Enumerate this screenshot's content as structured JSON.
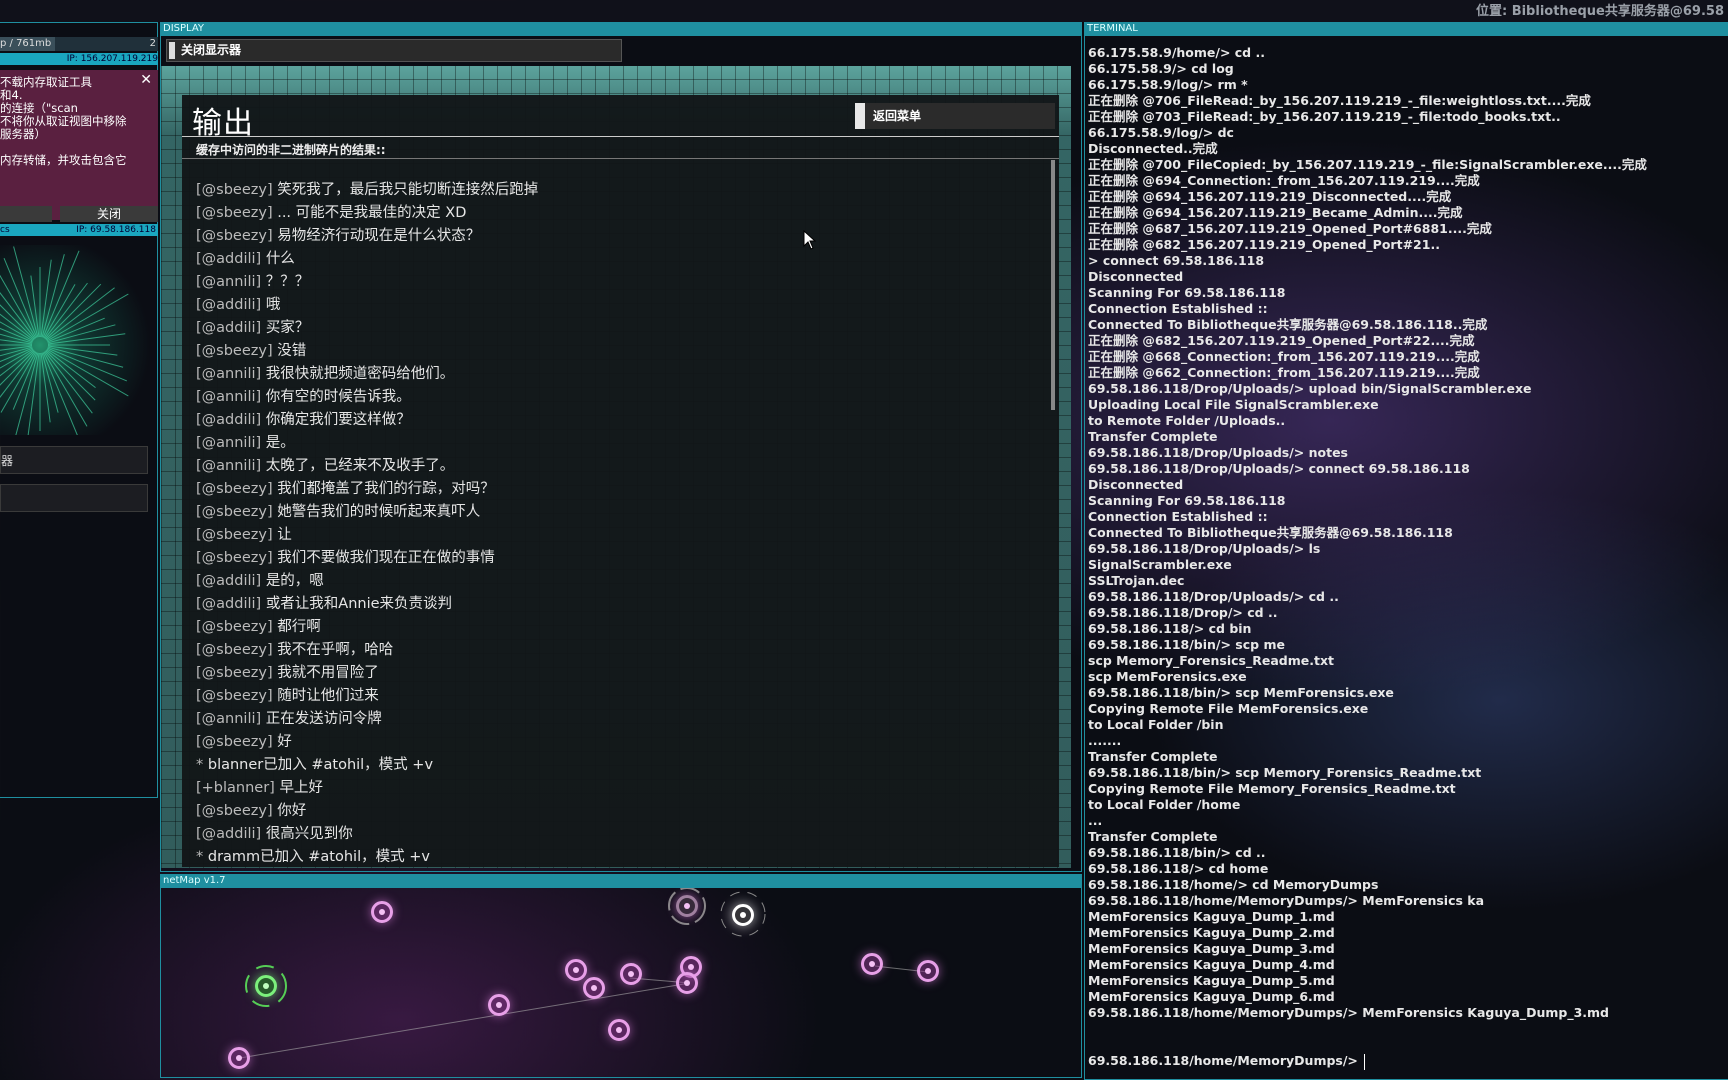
{
  "location": "位置: Bibliotheque共享服务器@69.58",
  "left": {
    "ram": "p / 761mb",
    "ram_fill": 0.35,
    "count": "2",
    "ip_top": "IP: 156.207.119.219",
    "notice_lines": [
      "不载内存取证工具",
      "和4.",
      "的连接（\"scan",
      "不将你从取证视图中移除",
      "服务器）",
      "",
      "内存转储，并攻击包含它"
    ],
    "close_x": "✕",
    "close_label": "关闭",
    "ip_bottom_left": "cs",
    "ip_bottom": "IP: 69.58.186.118",
    "box1": "器",
    "box2": ""
  },
  "display": {
    "header": "DISPLAY",
    "close_button": "关闭显示器",
    "title": "输出",
    "back_button": "返回菜单",
    "subtitle": "缓存中访问的非二进制碎片的结果::",
    "chat": [
      {
        "n": "[@sbeezy]",
        "t": "笑死我了，最后我只能切断连接然后跑掉"
      },
      {
        "n": "[@sbeezy]",
        "t": "... 可能不是我最佳的决定 XD"
      },
      {
        "n": "[@sbeezy]",
        "t": "易物经济行动现在是什么状态？"
      },
      {
        "n": "[@addili]",
        "t": "什么"
      },
      {
        "n": "[@annili]",
        "t": "？？？"
      },
      {
        "n": "[@addili]",
        "t": "哦"
      },
      {
        "n": "[@addili]",
        "t": "买家？"
      },
      {
        "n": "[@sbeezy]",
        "t": "没错"
      },
      {
        "n": "[@annili]",
        "t": "我很快就把频道密码给他们。"
      },
      {
        "n": "[@annili]",
        "t": "你有空的时候告诉我。"
      },
      {
        "n": "[@addili]",
        "t": "你确定我们要这样做？"
      },
      {
        "n": "[@annili]",
        "t": "是。"
      },
      {
        "n": "[@annili]",
        "t": "太晚了，已经来不及收手了。"
      },
      {
        "n": "[@sbeezy]",
        "t": "我们都掩盖了我们的行踪，对吗？"
      },
      {
        "n": "[@sbeezy]",
        "t": "她警告我们的时候听起来真吓人"
      },
      {
        "n": "[@sbeezy]",
        "t": "让"
      },
      {
        "n": "[@sbeezy]",
        "t": "我们不要做我们现在正在做的事情"
      },
      {
        "n": "[@addili]",
        "t": "是的，嗯"
      },
      {
        "n": "[@addili]",
        "t": "或者让我和Annie来负责谈判"
      },
      {
        "n": "[@sbeezy]",
        "t": "都行啊"
      },
      {
        "n": "[@sbeezy]",
        "t": "我不在乎啊，哈哈"
      },
      {
        "n": "[@sbeezy]",
        "t": "我就不用冒险了"
      },
      {
        "n": "[@sbeezy]",
        "t": "随时让他们过来"
      },
      {
        "n": "[@annili]",
        "t": "正在发送访问令牌"
      },
      {
        "n": "[@sbeezy]",
        "t": "好"
      },
      {
        "n": "*",
        "t": "blanner已加入 #atohil，模式 +v"
      },
      {
        "n": "[+blanner]",
        "t": "早上好"
      },
      {
        "n": "[@sbeezy]",
        "t": "你好"
      },
      {
        "n": "[@addili]",
        "t": "很高兴见到你"
      },
      {
        "n": "*",
        "t": "dramm已加入 #atohil，模式 +v"
      }
    ]
  },
  "netmap": {
    "header": "netMap v1.7"
  },
  "terminal": {
    "header": "TERMINAL",
    "lines": [
      "66.175.58.9/home/> cd ..",
      "66.175.58.9/> cd log",
      "66.175.58.9/log/> rm *",
      "正在删除 @706_FileRead:_by_156.207.119.219_-_file:weightloss.txt....完成",
      "正在删除 @703_FileRead:_by_156.207.119.219_-_file:todo_books.txt..",
      "66.175.58.9/log/> dc",
      "Disconnected..完成",
      "正在删除 @700_FileCopied:_by_156.207.119.219_-_file:SignalScrambler.exe....完成",
      "正在删除 @694_Connection:_from_156.207.119.219....完成",
      "正在删除 @694_156.207.119.219_Disconnected....完成",
      "正在删除 @694_156.207.119.219_Became_Admin....完成",
      "正在删除 @687_156.207.119.219_Opened_Port#6881....完成",
      "正在删除 @682_156.207.119.219_Opened_Port#21..",
      "> connect 69.58.186.118",
      "Disconnected",
      "Scanning For 69.58.186.118",
      "Connection Established ::",
      "Connected To Bibliotheque共享服务器@69.58.186.118..完成",
      "正在删除 @682_156.207.119.219_Opened_Port#22....完成",
      "正在删除 @668_Connection:_from_156.207.119.219....完成",
      "正在删除 @662_Connection:_from_156.207.119.219....完成",
      "69.58.186.118/Drop/Uploads/> upload bin/SignalScrambler.exe",
      "Uploading Local File SignalScrambler.exe",
      "to Remote Folder /Uploads..",
      "Transfer Complete",
      "69.58.186.118/Drop/Uploads/> notes",
      "69.58.186.118/Drop/Uploads/> connect 69.58.186.118",
      "Disconnected",
      "Scanning For 69.58.186.118",
      "Connection Established ::",
      "Connected To Bibliotheque共享服务器@69.58.186.118",
      "69.58.186.118/Drop/Uploads/> ls",
      "SignalScrambler.exe",
      "SSLTrojan.dec",
      "69.58.186.118/Drop/Uploads/> cd ..",
      "69.58.186.118/Drop/> cd ..",
      "69.58.186.118/> cd bin",
      "69.58.186.118/bin/> scp me",
      "scp Memory_Forensics_Readme.txt",
      "scp MemForensics.exe",
      "69.58.186.118/bin/> scp MemForensics.exe",
      "Copying Remote File MemForensics.exe",
      "to Local Folder /bin",
      ".......",
      "Transfer Complete",
      "69.58.186.118/bin/> scp Memory_Forensics_Readme.txt",
      "Copying Remote File Memory_Forensics_Readme.txt",
      "to Local Folder /home",
      "...",
      "Transfer Complete",
      "69.58.186.118/bin/> cd ..",
      "69.58.186.118/> cd home",
      "69.58.186.118/home/> cd MemoryDumps",
      "69.58.186.118/home/MemoryDumps/> MemForensics ka",
      "MemForensics Kaguya_Dump_1.md",
      "MemForensics Kaguya_Dump_2.md",
      "MemForensics Kaguya_Dump_3.md",
      "MemForensics Kaguya_Dump_4.md",
      "MemForensics Kaguya_Dump_5.md",
      "MemForensics Kaguya_Dump_6.md",
      "69.58.186.118/home/MemoryDumps/> MemForensics Kaguya_Dump_3.md"
    ],
    "prompt": "69.58.186.118/home/MemoryDumps/>"
  },
  "colors": {
    "accent": "#1f8fa0",
    "node": "#e8a0e8",
    "node_player": "#7cf07c",
    "notice_bg": "#5a2040"
  }
}
